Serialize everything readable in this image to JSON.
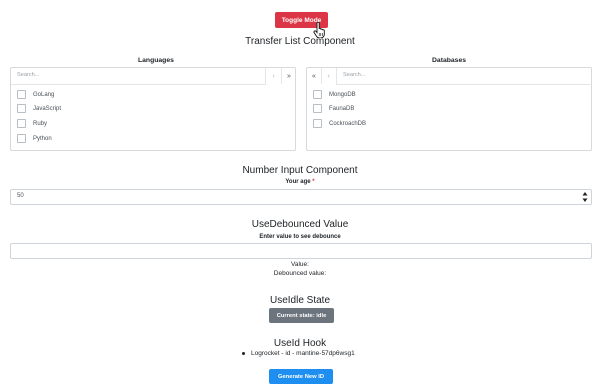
{
  "toggle": {
    "label": "Toggle Mode"
  },
  "transfer": {
    "title": "Transfer List Component",
    "left": {
      "title": "Languages",
      "search_placeholder": "Search...",
      "items": [
        "GoLang",
        "JavaScript",
        "Ruby",
        "Python"
      ],
      "btn_move_one": "›",
      "btn_move_all": "»"
    },
    "right": {
      "title": "Databases",
      "search_placeholder": "Search...",
      "items": [
        "MongoDB",
        "FaunaDB",
        "CockroachDB"
      ],
      "btn_move_all": "«",
      "btn_move_one": "‹"
    }
  },
  "number": {
    "title": "Number Input Component",
    "label": "Your age",
    "required_mark": "*",
    "value": "50"
  },
  "debounce": {
    "title": "UseDebounced Value",
    "label": "Enter value to see debounce",
    "value_label": "Value:",
    "debounced_label": "Debounced value:"
  },
  "idle": {
    "title": "UseIdle State",
    "button": "Current state: idle"
  },
  "id_hook": {
    "title": "UseId Hook",
    "item": "Logrocket - id - mantine-57dp6wsg1",
    "button": "Generate New ID"
  }
}
